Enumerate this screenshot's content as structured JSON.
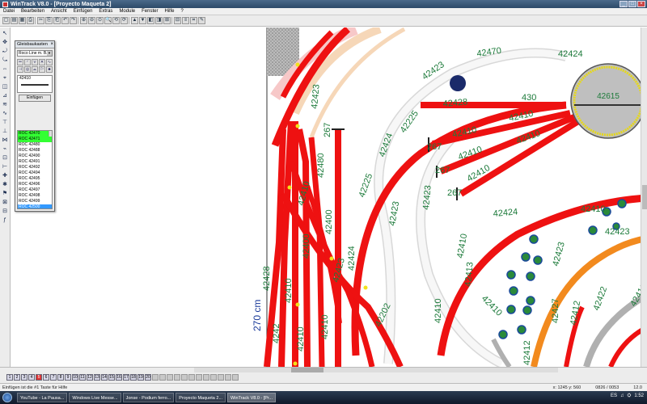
{
  "window": {
    "title": "WinTrack V8.0 - [Proyecto Maqueta 2]",
    "controls": [
      "_",
      "□",
      "×"
    ]
  },
  "menu": [
    "Datei",
    "Bearbeiten",
    "Ansicht",
    "Einfügen",
    "Extras",
    "Module",
    "Fenster",
    "Hilfe",
    "?"
  ],
  "toolbar": {
    "buttons": [
      "▢",
      "▤",
      "▦",
      "⎙",
      "✂",
      "⎘",
      "⎗",
      "↶",
      "↷",
      "⊕",
      "⊖",
      "⊙",
      "🔍",
      "⟲",
      "⟳",
      "▲",
      "▼",
      "◧",
      "◨",
      "⊞",
      "⊟",
      "≡",
      "⌗",
      "✎"
    ]
  },
  "left_tools": [
    "↖",
    "✥",
    "⤾",
    "⤿",
    "⇔",
    "⌖",
    "◫",
    "⊿",
    "≋",
    "∿",
    "⊤",
    "⊥",
    "⋈",
    "⌁",
    "⊡",
    "⊢",
    "✚",
    "✱",
    "⚑",
    "⊠",
    "⊟",
    "ƒ"
  ],
  "palette": {
    "title": "Gleisbaukasten",
    "close": "×",
    "selected_system": "Roco Line m. B.",
    "preview_label": "42410",
    "button": "Einfügen",
    "items": [
      {
        "text": "ROC 42470",
        "hl": "green"
      },
      {
        "text": "ROC 42471",
        "hl": "green"
      },
      {
        "text": "ROC 42480",
        "hl": ""
      },
      {
        "text": "ROC 42488",
        "hl": ""
      },
      {
        "text": "ROC 42490",
        "hl": ""
      },
      {
        "text": "ROC 42491",
        "hl": ""
      },
      {
        "text": "ROC 42492",
        "hl": ""
      },
      {
        "text": "ROC 42494",
        "hl": ""
      },
      {
        "text": "ROC 42495",
        "hl": ""
      },
      {
        "text": "ROC 42496",
        "hl": ""
      },
      {
        "text": "ROC 42497",
        "hl": ""
      },
      {
        "text": "ROC 42498",
        "hl": ""
      },
      {
        "text": "ROC 42499",
        "hl": ""
      },
      {
        "text": "ROC 42500",
        "hl": "blue"
      },
      {
        "text": "ROC 42502",
        "hl": ""
      }
    ]
  },
  "plan_labels": {
    "turntable": "42615",
    "left_dimension": "270 cm",
    "top_arc": "42470",
    "top_right": "42424",
    "stall_430": "430",
    "stall_a": "42428",
    "stall_b": "42410",
    "stall_c": "42410",
    "stall_d": "42410",
    "stall_e": "42410",
    "stall_f": "42410",
    "r267_a": "267",
    "r267_b": "267",
    "r267_c": "267",
    "r267_d": "267",
    "arc_42225_a": "42225",
    "arc_42225_b": "42225",
    "arc_42424_a": "42424",
    "arc_42423_a": "42423",
    "arc_42423_b": "42423",
    "arc_42423_c": "42423",
    "arc_42424_b": "42424",
    "right_42410": "42410",
    "right_42423": "42423",
    "right_42423b": "42423",
    "right_42412": "42412",
    "right_42422": "42422",
    "right_42410b": "42410",
    "vert_42428": "42428",
    "vert_42410a": "42410",
    "vert_42410b": "42410",
    "vert_42424": "42424",
    "vert_42202": "42202",
    "vert_42410c": "42410",
    "vert_42410d": "42410",
    "vert_42423": "42423",
    "vert_4242": "4242",
    "vert_42400": "42400",
    "lower_42410": "42410",
    "lower_42413": "42413",
    "lower_42410b": "42410",
    "lower_42410c": "42410",
    "lower_42412": "42412",
    "lower_42427": "42427",
    "top_42423": "42423",
    "mid_42480": "42480",
    "mid_42400": "42400"
  },
  "pages": [
    "1",
    "2",
    "3",
    "4",
    "5",
    "6",
    "7",
    "8",
    "9",
    "10",
    "11",
    "12",
    "13",
    "14",
    "15",
    "16",
    "17",
    "18",
    "19",
    "20"
  ],
  "active_page": "5",
  "status": {
    "left": "Einfügen ist die #1 Taste für Hilfe",
    "coords": "x: 1245 y: 560",
    "zoom": "0826 / 0053",
    "extra": "12.0"
  },
  "taskbar": {
    "tasks": [
      "YouTube - La Pausa...",
      "Windows Live Messe...",
      "Jonse - Podium ferro...",
      "Proyecto Maqueta 2...",
      "WinTrack V8.0 - [Pr..."
    ],
    "active": 4,
    "tray": [
      "ES",
      "♫",
      "⛭",
      "1:52"
    ]
  },
  "colors": {
    "track_red": "#ee1111",
    "track_white": "#f3f3f3",
    "track_orange": "#f28a1e",
    "track_pink": "#f7c8c8",
    "track_peach": "#f6d7b8",
    "track_gray": "#b0b0b0",
    "label_green": "#1c7a3a",
    "label_blue": "#1a3a9a",
    "turntable_fill": "#bfbfbf",
    "turntable_ring": "#e6d81a"
  }
}
